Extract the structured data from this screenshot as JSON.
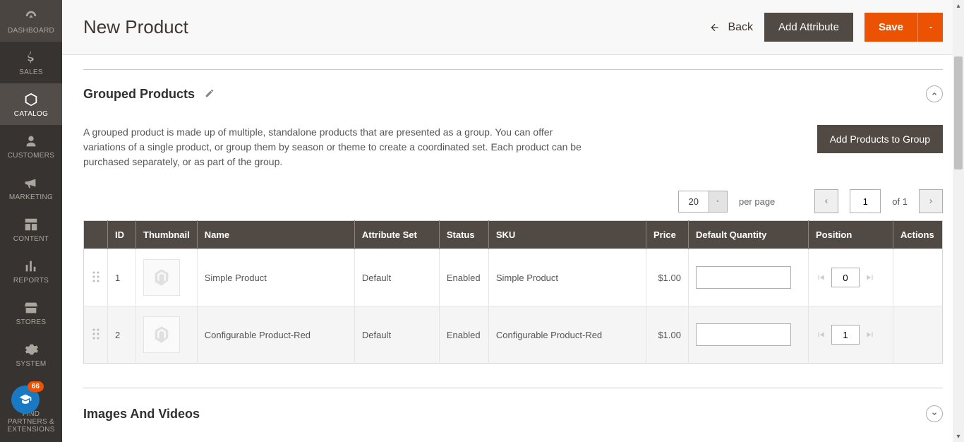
{
  "sidebar": {
    "items": [
      {
        "label": "DASHBOARD"
      },
      {
        "label": "SALES"
      },
      {
        "label": "CATALOG"
      },
      {
        "label": "CUSTOMERS"
      },
      {
        "label": "MARKETING"
      },
      {
        "label": "CONTENT"
      },
      {
        "label": "REPORTS"
      },
      {
        "label": "STORES"
      },
      {
        "label": "SYSTEM"
      },
      {
        "label": "FIND PARTNERS & EXTENSIONS"
      }
    ],
    "partners_badge_count": "66"
  },
  "header": {
    "title": "New Product",
    "back_label": "Back",
    "add_attribute_label": "Add Attribute",
    "save_label": "Save"
  },
  "grouped": {
    "section_title": "Grouped Products",
    "description": "A grouped product is made up of multiple, standalone products that are presented as a group. You can offer variations of a single product, or group them by season or theme to create a coordinated set. Each product can be purchased separately, or as part of the group.",
    "add_button_label": "Add Products to Group",
    "pager": {
      "page_size": "20",
      "per_page_label": "per page",
      "current_page": "1",
      "total_pages": "1",
      "of_label": "of"
    },
    "columns": {
      "id": "ID",
      "thumbnail": "Thumbnail",
      "name": "Name",
      "attribute_set": "Attribute Set",
      "status": "Status",
      "sku": "SKU",
      "price": "Price",
      "default_qty": "Default Quantity",
      "position": "Position",
      "actions": "Actions"
    },
    "rows": [
      {
        "id": "1",
        "name": "Simple Product",
        "attribute_set": "Default",
        "status": "Enabled",
        "sku": "Simple Product",
        "price": "$1.00",
        "default_qty": "",
        "position": "0"
      },
      {
        "id": "2",
        "name": "Configurable Product-Red",
        "attribute_set": "Default",
        "status": "Enabled",
        "sku": "Configurable Product-Red",
        "price": "$1.00",
        "default_qty": "",
        "position": "1"
      }
    ]
  },
  "sections": {
    "images_and_videos": "Images And Videos"
  }
}
